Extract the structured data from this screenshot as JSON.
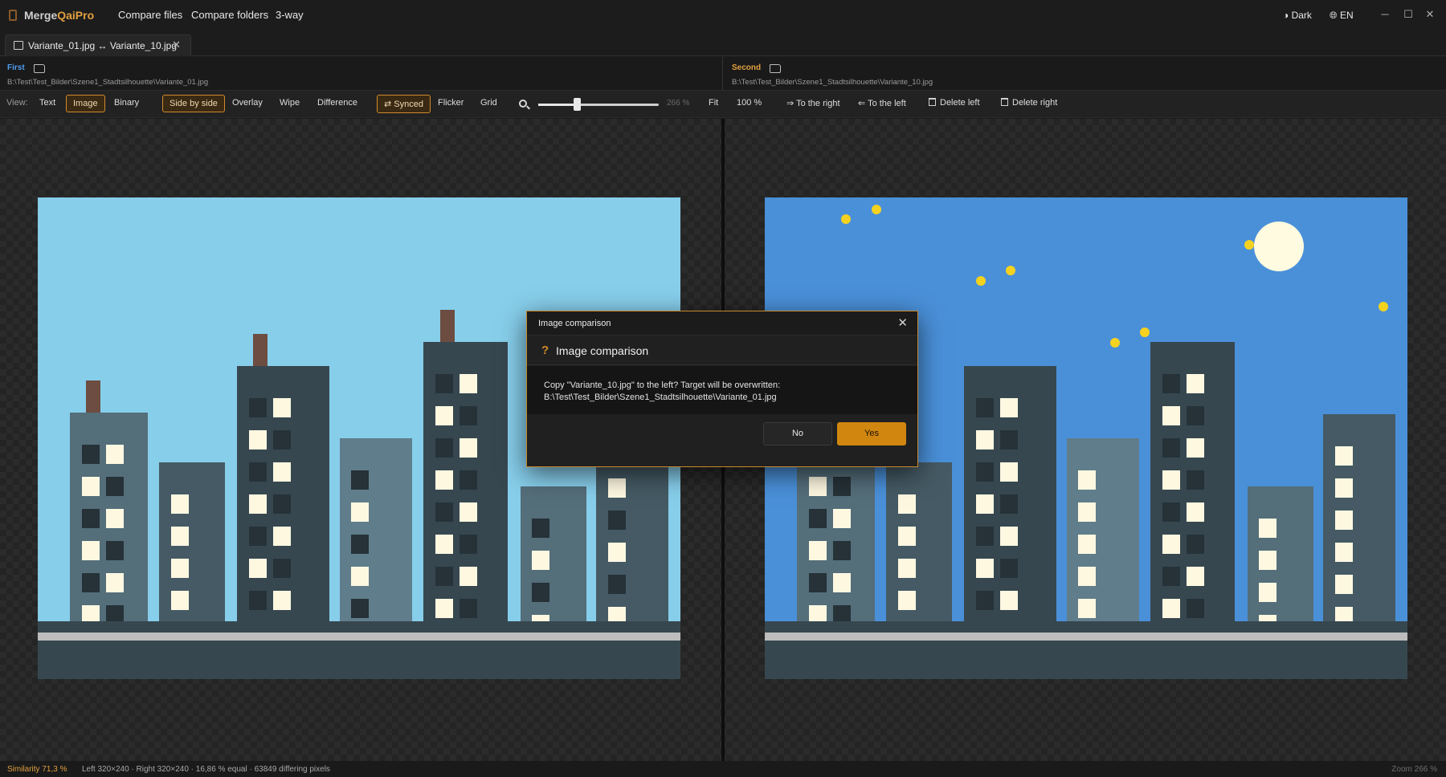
{
  "app": {
    "name_prefix": "Merge",
    "name_accent": "QaiPro"
  },
  "menu": {
    "compare_files": "Compare files",
    "compare_folders": "Compare folders",
    "three_way": "3-way"
  },
  "titlebar": {
    "theme": "Dark",
    "language": "EN",
    "minimize": "─",
    "maximize": "☐",
    "close": "✕"
  },
  "tab": {
    "label": "Variante_01.jpg ↔ Variante_10.jpg",
    "close": "✕"
  },
  "first": {
    "label": "First",
    "path": "B:\\Test\\Test_Bilder\\Szene1_Stadtsilhouette\\Variante_01.jpg",
    "label_color": "#4f9cf0"
  },
  "second": {
    "label": "Second",
    "path": "B:\\Test\\Test_Bilder\\Szene1_Stadtsilhouette\\Variante_10.jpg",
    "label_color": "#e2a03f"
  },
  "toolbar": {
    "view_label": "View:",
    "text": "Text",
    "image": "Image",
    "binary": "Binary",
    "side_by_side": "Side by side",
    "overlay": "Overlay",
    "wipe": "Wipe",
    "difference": "Difference",
    "synced": "⇄ Synced",
    "flicker": "Flicker",
    "grid": "Grid",
    "zoom_value_dim": "266 %",
    "zoom_slider_level": 0.32,
    "fit": "Fit",
    "hundred": "100 %",
    "to_right": "⇒ To the right",
    "to_left": "⇐ To the left",
    "delete_left": "Delete left",
    "delete_right": "Delete right"
  },
  "dialog": {
    "window_title": "Image comparison",
    "heading": "Image comparison",
    "question_icon": "?",
    "message": "Copy \"Variante_10.jpg\" to the left? Target will be overwritten: B:\\Test\\Test_Bilder\\Szene1_Stadtsilhouette\\Variante_01.jpg",
    "no": "No",
    "yes": "Yes",
    "close": "✕"
  },
  "status": {
    "similarity": "Similarity 71,3 %",
    "info": "Left 320×240 · Right 320×240 · 16,86 % equal · 63849 differing pixels",
    "zoom": "Zoom 266 %"
  },
  "colors": {
    "accent": "#d0860f",
    "left_sky": "#87ceeb",
    "right_sky": "#4a90d9",
    "window_lit": "#fff8e1",
    "window_dark": "#263238",
    "star": "#f5d21f",
    "moon": "#fffbe0"
  }
}
